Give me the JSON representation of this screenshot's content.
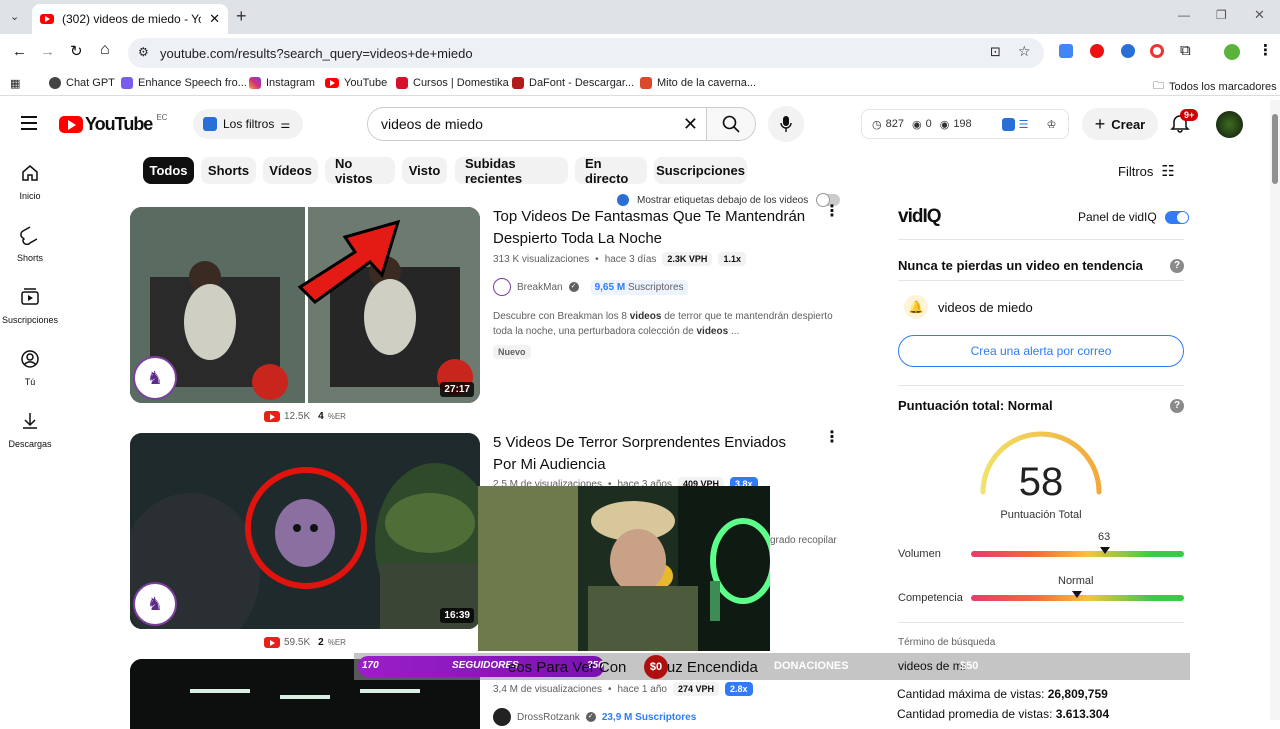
{
  "browser": {
    "tab_title": "(302) videos de miedo - YouTu",
    "url": "youtube.com/results?search_query=videos+de+miedo",
    "bookmarks": [
      "Chat GPT",
      "Enhance Speech fro...",
      "Instagram",
      "YouTube",
      "Cursos | Domestika",
      "DaFont - Descargar...",
      "Mito de la caverna..."
    ],
    "all_bookmarks": "Todos los marcadores"
  },
  "header": {
    "logo": "YouTube",
    "region": "EC",
    "filters_button": "Los filtros",
    "search_value": "videos de miedo",
    "stats": {
      "views": "827",
      "zero": "0",
      "eye": "198"
    },
    "create": "Crear",
    "notifications": "9+"
  },
  "sidebar": [
    "Inicio",
    "Shorts",
    "Suscripciones",
    "Tú",
    "Descargas"
  ],
  "chips": [
    "Todos",
    "Shorts",
    "Vídeos",
    "No vistos",
    "Visto",
    "Subidas recientes",
    "En directo",
    "Suscripciones"
  ],
  "filters_label": "Filtros",
  "labels_toggle": "Mostrar etiquetas debajo de los videos",
  "videos": [
    {
      "title": "Top Videos De Fantasmas Que Te Mantendrán Despierto Toda La Noche",
      "views": "313 K visualizaciones",
      "age": "hace 3 días",
      "vph": "2.3K VPH",
      "mult": "1.1x",
      "channel": "BreakMan",
      "subs_num": "9,65 M",
      "subs_label": "Suscriptores",
      "desc_a": "Descubre con Breakman los 8 ",
      "desc_b": "videos",
      "desc_c": " de terror que te mantendrán despierto toda la noche, una perturbadora colección de ",
      "desc_d": "videos",
      "desc_e": " ...",
      "badge": "Nuevo",
      "duration": "27:17",
      "stat_count": "12.5K",
      "stat_er": "4",
      "er_label": "%ER"
    },
    {
      "title": "5 Videos De Terror Sorprendentes Enviados Por Mi Audiencia",
      "views": "2,5 M de visualizaciones",
      "age": "hace 3 años",
      "vph": "409 VPH",
      "mult": "3.8x",
      "desc_tail": "grado recopilar",
      "duration": "16:39",
      "stat_count": "59.5K",
      "stat_er": "2",
      "er_label": "%ER"
    },
    {
      "title_a": "eos Para Ver Con",
      "title_b": "Luz Encendida",
      "views": "3,4 M de visualizaciones",
      "age": "hace 1 año",
      "vph": "274 VPH",
      "mult": "2.8x",
      "channel": "DrossRotzank",
      "subs": "23,9 M Suscriptores"
    }
  ],
  "vidiq": {
    "logo": "vidIQ",
    "panel_label": "Panel de vidIQ",
    "trend_title": "Nunca te pierdas un video en tendencia",
    "trend_term": "videos de miedo",
    "alert_button": "Crea una alerta por correo",
    "score_title": "Puntuación total: Normal",
    "score": "58",
    "score_label": "Puntuación Total",
    "volume_label": "Volumen",
    "volume_value": "63",
    "competition_label": "Competencia",
    "competition_value": "Normal",
    "search_term_label": "Término de búsqueda",
    "search_term": "videos de mi",
    "max_views_label": "Cantidad máxima de vistas: ",
    "max_views": "26,809,759",
    "avg_views_label": "Cantidad promedia de vistas: ",
    "avg_views": "3.613.304"
  },
  "overlay": {
    "followers_count": "170",
    "followers_label": "SEGUIDORES",
    "followers_goal": "250",
    "donation_amount": "$0",
    "donations_label": "DONACIONES",
    "donation_goal": "$50"
  }
}
